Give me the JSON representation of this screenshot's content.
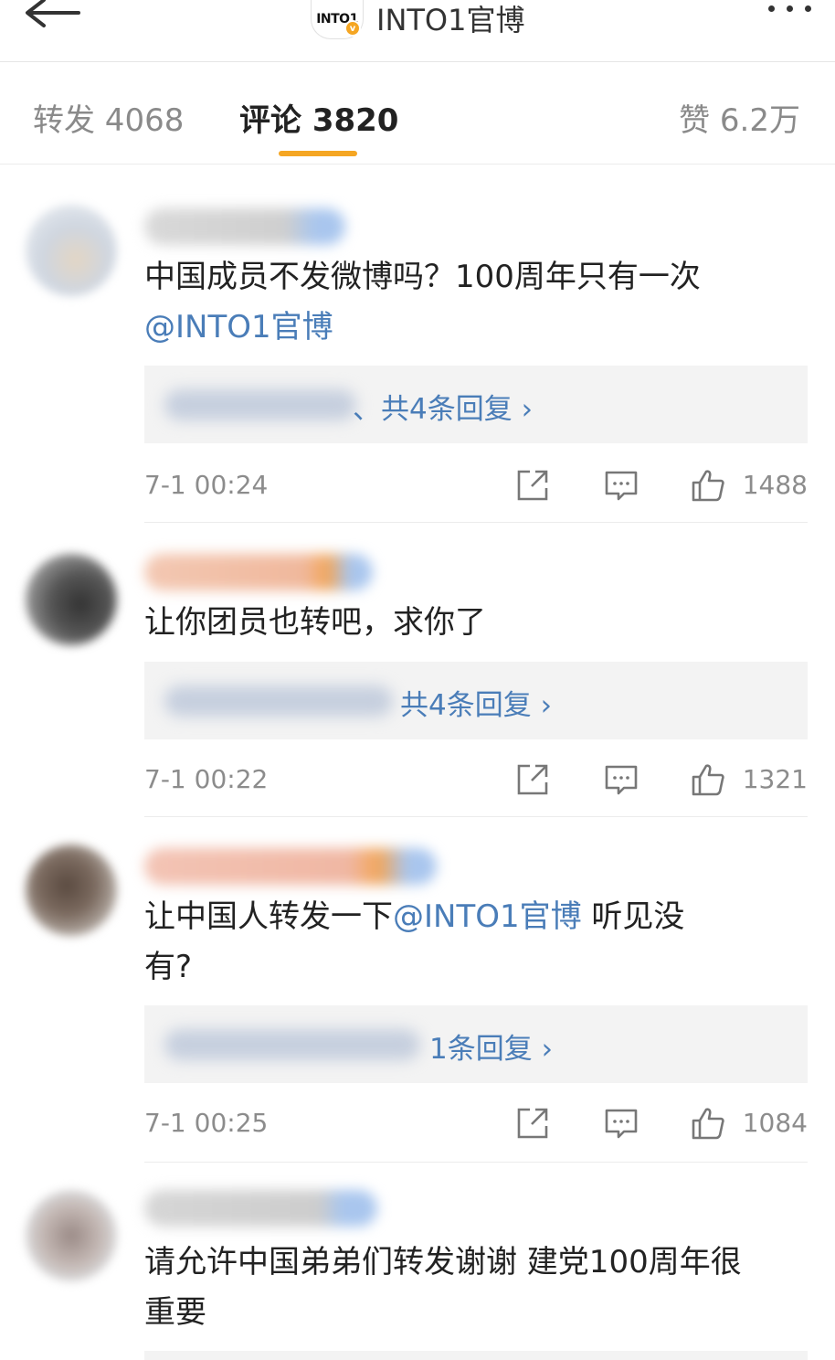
{
  "header": {
    "account_logo": "INTO1",
    "account_name": "INTO1官博",
    "back_icon": "back-arrow-icon",
    "more_icon": "more-dots-icon"
  },
  "tabs": [
    {
      "label": "转发 4068"
    },
    {
      "label": "评论 3820",
      "active": true
    },
    {
      "label": "赞 6.2万"
    }
  ],
  "comments": [
    {
      "text": "中国成员不发微博吗？100周年只有一次",
      "mention": "@INTO1官博",
      "reply_summary": "、共4条回复 ›",
      "time": "7-1 00:24",
      "likes": "1488"
    },
    {
      "text": "让你团员也转吧，求你了",
      "reply_summary": "共4条回复 ›",
      "time": "7-1 00:22",
      "likes": "1321"
    },
    {
      "text_before": "让中国人转发一下",
      "mention": "@INTO1官博",
      "text_after": " 听见没",
      "text_line2": "有?",
      "reply_summary": "1条回复 ›",
      "time": "7-1 00:25",
      "likes": "1084"
    },
    {
      "text": "请允许中国弟弟们转发谢谢 建党100周年很",
      "text_line2": "重要"
    }
  ],
  "colors": {
    "accent": "#f5a623",
    "link": "#4a7db8"
  }
}
